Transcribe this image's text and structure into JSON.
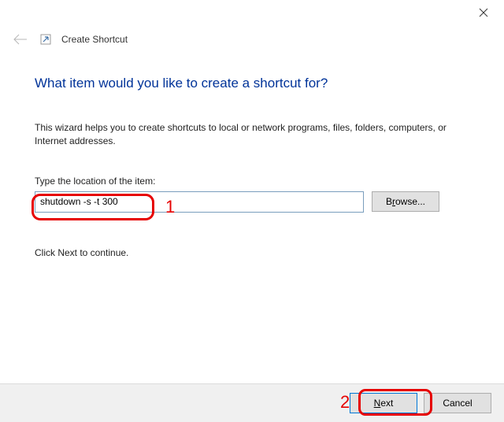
{
  "titlebar": {},
  "header": {
    "title": "Create Shortcut"
  },
  "main": {
    "heading": "What item would you like to create a shortcut for?",
    "description": "This wizard helps you to create shortcuts to local or network programs, files, folders, computers, or Internet addresses.",
    "location_label": "Type the location of the item:",
    "location_value": "shutdown -s -t 300",
    "browse_label": "Browse...",
    "continue_text": "Click Next to continue."
  },
  "footer": {
    "next_label": "Next",
    "cancel_label": "Cancel"
  },
  "annotations": {
    "num1": "1",
    "num2": "2"
  }
}
